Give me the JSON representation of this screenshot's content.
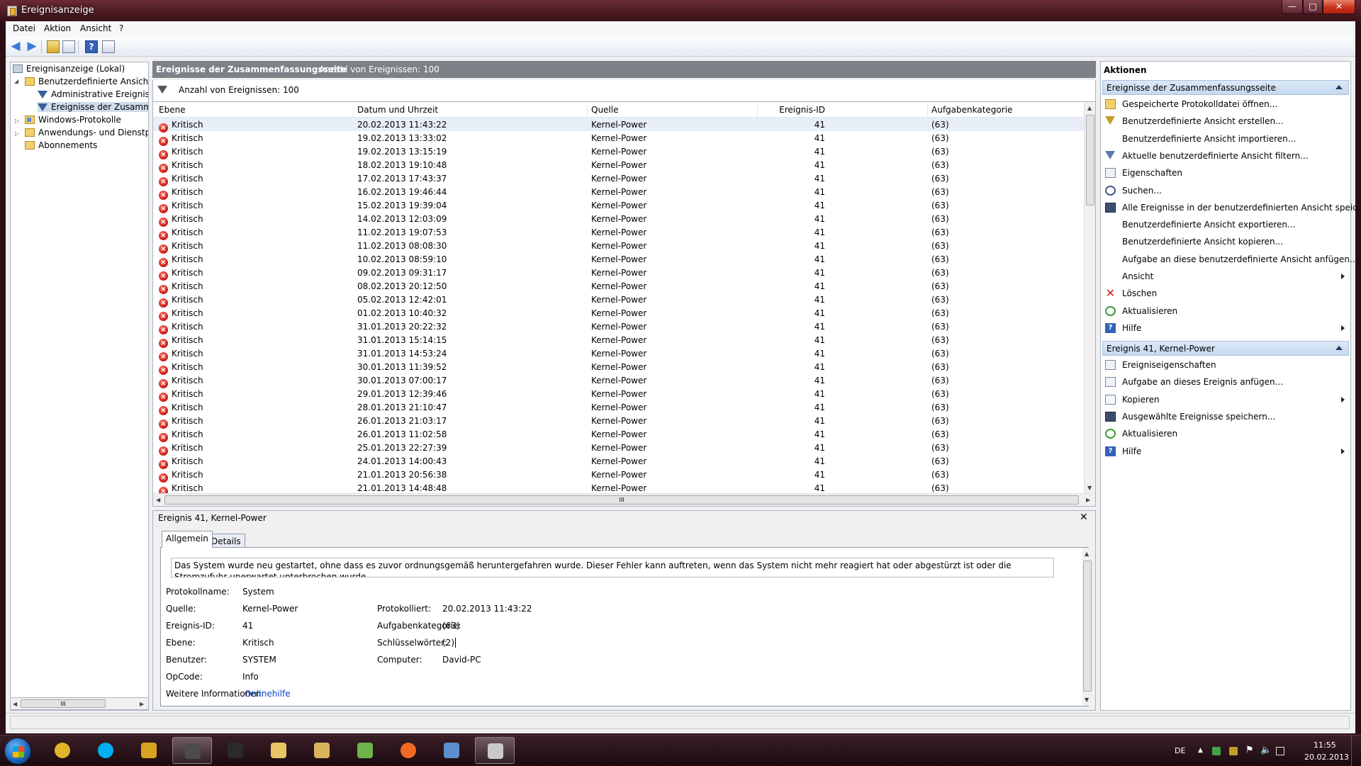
{
  "window": {
    "title": "Ereignisanzeige",
    "minimize": "—",
    "maximize": "□",
    "close": "✕"
  },
  "menu": [
    "Datei",
    "Aktion",
    "Ansicht",
    "?"
  ],
  "toolbar": {
    "help": "?"
  },
  "tree": {
    "root": "Ereignisanzeige (Lokal)",
    "custom_views": "Benutzerdefinierte Ansichten",
    "admin_events": "Administrative Ereignisse",
    "summary_events": "Ereignisse der Zusammenfassungsseite",
    "windows_logs": "Windows-Protokolle",
    "app_logs": "Anwendungs- und Dienstprotokolle",
    "subscriptions": "Abonnements",
    "scroll_grip": "III"
  },
  "center": {
    "title": "Ereignisse der Zusammenfassungsseite",
    "count_header": "Anzahl von Ereignissen: 100",
    "filter_text": "Anzahl von Ereignissen: 100",
    "columns": [
      "Ebene",
      "Datum und Uhrzeit",
      "Quelle",
      "Ereignis-ID",
      "Aufgabenkategorie"
    ],
    "level": "Kritisch",
    "source": "Kernel-Power",
    "event_id": "41",
    "category": "(63)",
    "dates": [
      "20.02.2013 11:43:22",
      "19.02.2013 13:33:02",
      "19.02.2013 13:15:19",
      "18.02.2013 19:10:48",
      "17.02.2013 17:43:37",
      "16.02.2013 19:46:44",
      "15.02.2013 19:39:04",
      "14.02.2013 12:03:09",
      "11.02.2013 19:07:53",
      "11.02.2013 08:08:30",
      "10.02.2013 08:59:10",
      "09.02.2013 09:31:17",
      "08.02.2013 20:12:50",
      "05.02.2013 12:42:01",
      "01.02.2013 10:40:32",
      "31.01.2013 20:22:32",
      "31.01.2013 15:14:15",
      "31.01.2013 14:53:24",
      "30.01.2013 11:39:52",
      "30.01.2013 07:00:17",
      "29.01.2013 12:39:46",
      "28.01.2013 21:10:47",
      "26.01.2013 21:03:17",
      "26.01.2013 11:02:58",
      "25.01.2013 22:27:39",
      "24.01.2013 14:00:43",
      "21.01.2013 20:56:38",
      "21.01.2013 14:48:48"
    ],
    "hscroll_grip": "III"
  },
  "detail": {
    "title": "Ereignis 41, Kernel-Power",
    "close": "✕",
    "tabs": [
      "Allgemein",
      "Details"
    ],
    "description": "Das System wurde neu gestartet, ohne dass es zuvor ordnungsgemäß heruntergefahren wurde. Dieser Fehler kann auftreten, wenn das System nicht mehr reagiert hat oder abgestürzt ist oder die Stromzufuhr unerwartet unterbrochen wurde.",
    "labels": {
      "log": "Protokollname:",
      "source": "Quelle:",
      "event_id": "Ereignis-ID:",
      "level": "Ebene:",
      "user": "Benutzer:",
      "opcode": "OpCode:",
      "more": "Weitere Informationen:",
      "logged": "Protokolliert:",
      "category": "Aufgabenkategorie:",
      "keywords": "Schlüsselwörter:",
      "computer": "Computer:"
    },
    "values": {
      "log": "System",
      "source": "Kernel-Power",
      "event_id": "41",
      "level": "Kritisch",
      "user": "SYSTEM",
      "opcode": "Info",
      "more": "Onlinehilfe",
      "logged": "20.02.2013 11:43:22",
      "category": "(63)",
      "keywords": "(2)",
      "computer": "David-PC"
    }
  },
  "actions": {
    "title": "Aktionen",
    "section1": "Ereignisse der Zusammenfassungsseite",
    "section1_items": [
      {
        "label": "Gespeicherte Protokolldatei öffnen...",
        "icon": "folder-open-icon"
      },
      {
        "label": "Benutzerdefinierte Ansicht erstellen...",
        "icon": "filter-create-icon"
      },
      {
        "label": "Benutzerdefinierte Ansicht importieren...",
        "icon": ""
      },
      {
        "label": "Aktuelle benutzerdefinierte Ansicht filtern...",
        "icon": "filter-icon"
      },
      {
        "label": "Eigenschaften",
        "icon": "properties-icon"
      },
      {
        "label": "Suchen...",
        "icon": "binoculars-icon"
      },
      {
        "label": "Alle Ereignisse in der benutzerdefinierten Ansicht speic...",
        "icon": "save-icon"
      },
      {
        "label": "Benutzerdefinierte Ansicht exportieren...",
        "icon": ""
      },
      {
        "label": "Benutzerdefinierte Ansicht kopieren...",
        "icon": ""
      },
      {
        "label": "Aufgabe an diese benutzerdefinierte Ansicht anfügen...",
        "icon": ""
      },
      {
        "label": "Ansicht",
        "icon": "",
        "submenu": true
      },
      {
        "label": "Löschen",
        "icon": "delete-icon"
      },
      {
        "label": "Aktualisieren",
        "icon": "refresh-icon"
      },
      {
        "label": "Hilfe",
        "icon": "help-icon",
        "submenu": true
      }
    ],
    "section2": "Ereignis 41, Kernel-Power",
    "section2_items": [
      {
        "label": "Ereigniseigenschaften",
        "icon": "properties-icon"
      },
      {
        "label": "Aufgabe an dieses Ereignis anfügen...",
        "icon": "task-icon"
      },
      {
        "label": "Kopieren",
        "icon": "copy-icon",
        "submenu": true
      },
      {
        "label": "Ausgewählte Ereignisse speichern...",
        "icon": "save-icon"
      },
      {
        "label": "Aktualisieren",
        "icon": "refresh-icon"
      },
      {
        "label": "Hilfe",
        "icon": "help-icon",
        "submenu": true
      }
    ]
  },
  "taskbar": {
    "lang": "DE",
    "time": "11:55",
    "date": "20.02.2013",
    "apps": [
      {
        "name": "chrome-icon",
        "color": "#e0b52a"
      },
      {
        "name": "skype-icon",
        "color": "#00aff0"
      },
      {
        "name": "winamp-icon",
        "color": "#d9a321"
      },
      {
        "name": "steam-icon",
        "color": "#4b4b4b"
      },
      {
        "name": "headset-icon",
        "color": "#2a2a2a"
      },
      {
        "name": "explorer-icon",
        "color": "#e9c464"
      },
      {
        "name": "folder-icon",
        "color": "#d9b45c"
      },
      {
        "name": "messenger-icon",
        "color": "#6fb34b"
      },
      {
        "name": "origin-icon",
        "color": "#f26a21"
      },
      {
        "name": "control-panel-icon",
        "color": "#5c8fcc"
      },
      {
        "name": "event-viewer-icon",
        "color": "#c9c9c9"
      }
    ]
  }
}
